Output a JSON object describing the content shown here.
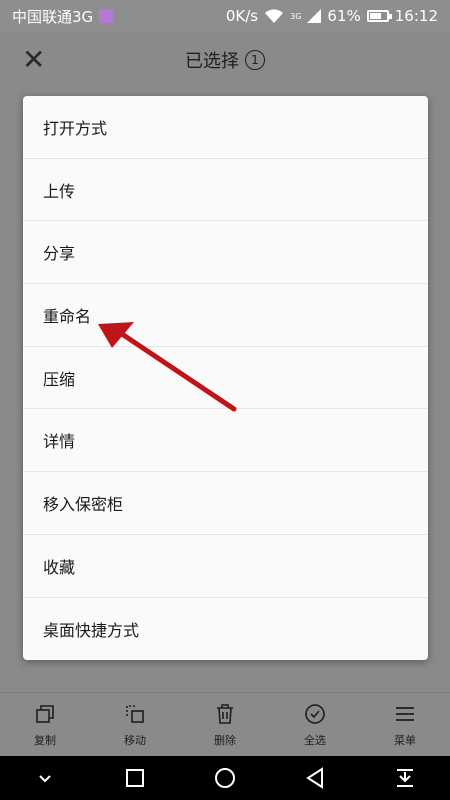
{
  "status_bar": {
    "carrier": "中国联通3G",
    "speed": "0K/s",
    "signal": "3G",
    "battery": "61%",
    "battery_level": 0.61,
    "time": "16:12"
  },
  "header": {
    "title": "已选择",
    "count": "1"
  },
  "menu": {
    "items": [
      {
        "label": "打开方式"
      },
      {
        "label": "上传"
      },
      {
        "label": "分享"
      },
      {
        "label": "重命名"
      },
      {
        "label": "压缩"
      },
      {
        "label": "详情"
      },
      {
        "label": "移入保密柜"
      },
      {
        "label": "收藏"
      },
      {
        "label": "桌面快捷方式"
      }
    ]
  },
  "toolbar": {
    "items": [
      {
        "label": "复制",
        "icon": "copy-icon"
      },
      {
        "label": "移动",
        "icon": "move-icon"
      },
      {
        "label": "删除",
        "icon": "trash-icon"
      },
      {
        "label": "全选",
        "icon": "select-all-icon"
      },
      {
        "label": "菜单",
        "icon": "menu-icon"
      }
    ]
  },
  "colors": {
    "dim_background": "#8a8a8a",
    "menu_background": "#fafafa",
    "annotation_arrow": "#c0141b"
  }
}
